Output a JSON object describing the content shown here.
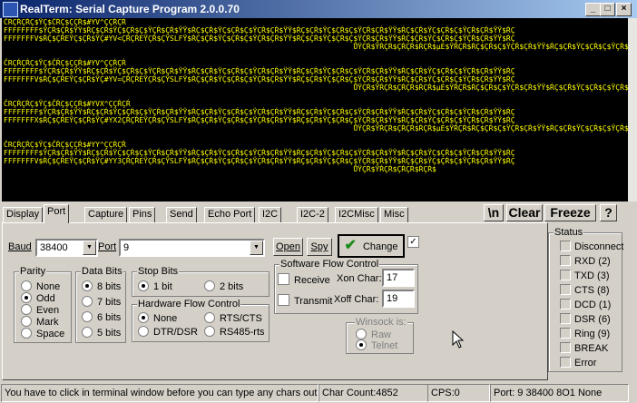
{
  "window": {
    "title": "RealTerm: Serial Capture Program 2.0.0.70",
    "min": "_",
    "max": "□",
    "close": "×"
  },
  "terminal": {
    "lines": [
      "ČRÇŔÇŔÇ$ŸÇ$ČŔÇ$ÇÇŔ$#YV^ÇÇŔÇŔ",
      "FFFFFFFF$ŸÇŔ$ÇŔ$ŸŸ$ŔÇ$ÇŔ$ŸÇ$ÇŔ$Ç$ŸÇŔ$ÇŔ$ŸŸ$ŔÇ$ÇŔ$ŸÇ$ÇŔ$Ç$ŸÇŔ$ÇŔ$ŸŸ$ŔÇ$ÇŔ$ŸÇ$ÇŔ$Ç$ŸÇŔ$ÇŔ$ŸŸ$ŔÇ$ÇŔ$ŸÇ$ÇŔ$Ç$ŸÇŔ$ÇŔ$ŸŸ$ŔÇ",
      "FFFFFFFV$ŔÇ$ÇŔEŸÇ$ÇŔ$ŸÇ#YV<ÇŔÇŔEŸÇŔ$ÇŸSLFŸ$ŔÇ$ÇŔ$ŸÇ$ÇŔ$Ç$ŸÇŔ$ÇŔ$ŸŸ$ŔÇ$ÇŔ$ŸÇ$ÇŔ$Ç$ŸÇŔ$ÇŔ$ŸŸ$ŔÇ$ÇŔ$ŸÇ$ÇŔ$Ç$ŸÇŔ$ÇŔ$ŸŸ$ŔÇ",
      "                                                                                ŮŸÇŔ$ŸŔÇŔ$ÇŔÇŔ$ŔÇŔ$µE$ŸŔÇŔ$ŔÇ$ÇŔ$Ç$ŸÇŔ$ÇŔ$ŸŸ$ŔÇ$ÇŔ$ŸÇ$ÇŔ$Ç$ŸÇŔ$ÇŔ$ŸŸ$ŔÇ",
      "",
      "ČRÇŔÇŔÇ$ŸÇ$ČŔÇ$ÇÇŔ$#YV^ÇÇŔÇŔ",
      "FFFFFFFF$ŸÇŔ$ÇŔ$ŸŸ$ŔÇ$ÇŔ$ŸÇ$ÇŔ$Ç$ŸÇŔ$ÇŔ$ŸŸ$ŔÇ$ÇŔ$ŸÇ$ÇŔ$Ç$ŸÇŔ$ÇŔ$ŸŸ$ŔÇ$ÇŔ$ŸÇ$ÇŔ$Ç$ŸÇŔ$ÇŔ$ŸŸ$ŔÇ$ÇŔ$ŸÇ$ÇŔ$Ç$ŸÇŔ$ÇŔ$ŸŸ$ŔÇ",
      "FFFFFFFV$ŔÇ$ÇŔEŸÇ$ÇŔ$ŸÇ#YV=ÇŔÇŔEŸÇŔ$ÇŸSLFŸ$ŔÇ$ÇŔ$ŸÇ$ÇŔ$Ç$ŸÇŔ$ÇŔ$ŸŸ$ŔÇ$ÇŔ$ŸÇ$ÇŔ$Ç$ŸÇŔ$ÇŔ$ŸŸ$ŔÇ$ÇŔ$ŸÇ$ÇŔ$Ç$ŸÇŔ$ÇŔ$ŸŸ$ŔÇ",
      "                                                                                ŮŸÇŔ$ŸŔÇŔ$ÇŔÇŔ$ŔÇŔ$µE$ŸŔÇŔ$ŔÇ$ÇŔ$Ç$ŸÇŔ$ÇŔ$ŸŸ$ŔÇ$ÇŔ$ŸÇ$ÇŔ$Ç$ŸÇŔ$ÇŔ$ŸŸ$ŔÇ",
      "",
      "ČRÇŔÇŔÇ$ŸÇ$ČŔÇ$ÇÇŔ$#YVX^ÇÇŔÇŔ",
      "FFFFFFFF$ŸÇŔ$ÇŔ$ŸŸ$ŔÇ$ÇŔ$ŸÇ$ÇŔ$Ç$ŸÇŔ$ÇŔ$ŸŸ$ŔÇ$ÇŔ$ŸÇ$ÇŔ$Ç$ŸÇŔ$ÇŔ$ŸŸ$ŔÇ$ÇŔ$ŸÇ$ÇŔ$Ç$ŸÇŔ$ÇŔ$ŸŸ$ŔÇ$ÇŔ$ŸÇ$ÇŔ$Ç$ŸÇŔ$ÇŔ$ŸŸ$ŔÇ",
      "FFFFFFFX$ŔÇ$ÇŔEŸÇ$ÇŔ$ŸÇ#YX2ÇŔÇŔEŸÇŔ$ÇŸSLFŸ$ŔÇ$ÇŔ$ŸÇ$ÇŔ$Ç$ŸÇŔ$ÇŔ$ŸŸ$ŔÇ$ÇŔ$ŸÇ$ÇŔ$Ç$ŸÇŔ$ÇŔ$ŸŸ$ŔÇ$ÇŔ$ŸÇ$ÇŔ$Ç$ŸÇŔ$ÇŔ$ŸŸ$ŔÇ",
      "                                                                                ŮŸÇŔ$ŸŔÇŔ$ÇŔÇŔ$ŔÇŔ$µE$ŸŔÇŔ$ŔÇ$ÇŔ$Ç$ŸÇŔ$ÇŔ$ŸŸ$ŔÇ$ÇŔ$ŸÇ$ÇŔ$Ç$ŸÇŔ$ÇŔ$ŸŸ$ŔÇ",
      "",
      "ČRÇŔÇŔÇ$ŸÇ$ČŔÇ$ÇÇŔ$#YY^ÇÇŔÇŔ",
      "FFFFFFFF$ŸÇŔ$ÇŔ$ŸŸ$ŔÇ$ÇŔ$ŸÇ$ÇŔ$Ç$ŸÇŔ$ÇŔ$ŸŸ$ŔÇ$ÇŔ$ŸÇ$ÇŔ$Ç$ŸÇŔ$ÇŔ$ŸŸ$ŔÇ$ÇŔ$ŸÇ$ÇŔ$Ç$ŸÇŔ$ÇŔ$ŸŸ$ŔÇ$ÇŔ$ŸÇ$ÇŔ$Ç$ŸÇŔ$ÇŔ$ŸŸ$ŔÇ",
      "FFFFFFFV$ŔÇ$ÇŔEŸÇ$ÇŔ$ŸÇ#YY3ÇŔÇŔEŸÇŔ$ÇŸSLFŸ$ŔÇ$ÇŔ$ŸÇ$ÇŔ$Ç$ŸÇŔ$ÇŔ$ŸŸ$ŔÇ$ÇŔ$ŸÇ$ÇŔ$Ç$ŸÇŔ$ÇŔ$ŸŸ$ŔÇ$ÇŔ$ŸÇ$ÇŔ$Ç$ŸÇŔ$ÇŔ$ŸŸ$ŔÇ",
      "                                                                                ŮŸÇŔ$ŸŔÇŔ$ÇŔÇŔ$ŔÇŔ$"
    ],
    "text_color": "#ffff00",
    "background": "#000000"
  },
  "tabs": [
    {
      "label": "Display"
    },
    {
      "label": "Port"
    },
    {
      "label": "Capture"
    },
    {
      "label": "Pins"
    },
    {
      "label": "Send"
    },
    {
      "label": "Echo Port"
    },
    {
      "label": "I2C"
    },
    {
      "label": "I2C-2"
    },
    {
      "label": "I2CMisc"
    },
    {
      "label": "Misc"
    }
  ],
  "active_tab": "Port",
  "toolbar": {
    "newline": "\\n",
    "clear": "Clear",
    "freeze": "Freeze",
    "help": "?"
  },
  "port": {
    "baud_label": "Baud",
    "baud_value": "38400",
    "port_label": "Port",
    "port_value": "9",
    "open_label": "Open",
    "spy_label": "Spy",
    "change_label": "Change"
  },
  "parity": {
    "title": "Parity",
    "options": [
      "None",
      "Odd",
      "Even",
      "Mark",
      "Space"
    ],
    "selected": "Odd"
  },
  "data_bits": {
    "title": "Data Bits",
    "options": [
      "8 bits",
      "7 bits",
      "6 bits",
      "5 bits"
    ],
    "selected": "8 bits"
  },
  "stop_bits": {
    "title": "Stop Bits",
    "options": [
      "1 bit",
      "2 bits"
    ],
    "selected": "1 bit"
  },
  "hw_flow": {
    "title": "Hardware Flow Control",
    "options": [
      "None",
      "RTS/CTS",
      "DTR/DSR",
      "RS485-rts"
    ],
    "selected": "None"
  },
  "sw_flow": {
    "title": "Software Flow Control",
    "receive_label": "Receive",
    "transmit_label": "Transmit",
    "xon_label": "Xon Char:",
    "xon_value": "17",
    "xoff_label": "Xoff Char:",
    "xoff_value": "19"
  },
  "winsock": {
    "title": "Winsock is:",
    "options": [
      "Raw",
      "Telnet"
    ],
    "selected": "Telnet"
  },
  "status": {
    "title": "Status",
    "items": [
      "Disconnect",
      "RXD (2)",
      "TXD (3)",
      "CTS (8)",
      "DCD (1)",
      "DSR (6)",
      "Ring (9)",
      "BREAK",
      "Error"
    ]
  },
  "statusbar": {
    "hint": "You have to click in terminal window before you can type any chars out",
    "char_count": "Char Count:4852",
    "cps": "CPS:0",
    "port_info": "Port: 9 38400 8O1 None"
  }
}
